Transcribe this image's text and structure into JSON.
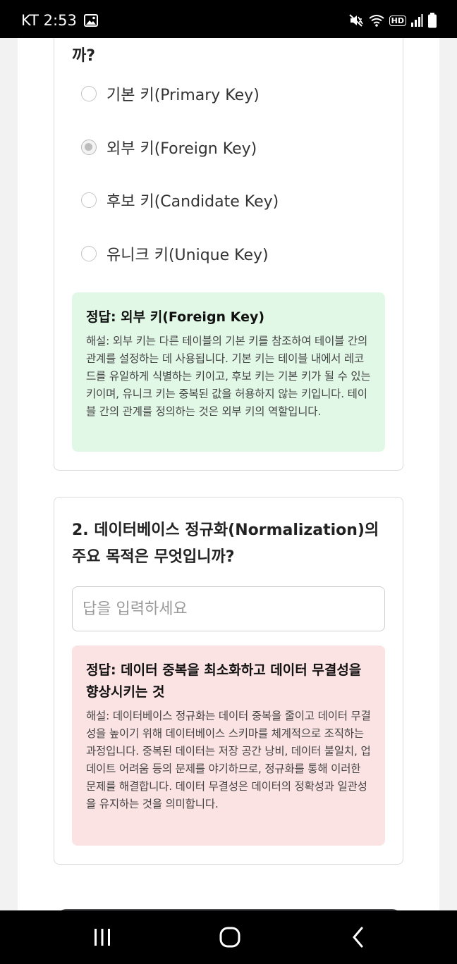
{
  "status_bar": {
    "carrier_time": "KT 2:53",
    "hd_label": "HD",
    "icons": [
      "image-icon",
      "mute-icon",
      "wifi-icon",
      "hd-icon",
      "signal-icon",
      "battery-icon"
    ]
  },
  "question1": {
    "title_tail": "까?",
    "options": [
      {
        "label": "기본 키(Primary Key)",
        "selected": false
      },
      {
        "label": "외부 키(Foreign Key)",
        "selected": true
      },
      {
        "label": "후보 키(Candidate Key)",
        "selected": false
      },
      {
        "label": "유니크 키(Unique Key)",
        "selected": false
      }
    ],
    "answer": {
      "title": "정답: 외부 키(Foreign Key)",
      "explanation": "해설: 외부 키는 다른 테이블의 기본 키를 참조하여 테이블 간의 관계를 설정하는 데 사용됩니다. 기본 키는 테이블 내에서 레코드를 유일하게 식별하는 키이고, 후보 키는 기본 키가 될 수 있는 키이며, 유니크 키는 중복된 값을 허용하지 않는 키입니다. 테이블 간의 관계를 정의하는 것은 외부 키의 역할입니다.",
      "color": "#e1f8e6"
    }
  },
  "question2": {
    "title": "2. 데이터베이스 정규화(Normalization)의 주요 목적은 무엇입니까?",
    "input": {
      "value": "",
      "placeholder": "답을 입력하세요"
    },
    "answer": {
      "title": "정답: 데이터 중복을 최소화하고 데이터 무결성을 향상시키는 것",
      "explanation": "해설: 데이터베이스 정규화는 데이터 중복을 줄이고 데이터 무결성을 높이기 위해 데이터베이스 스키마를 체계적으로 조직하는 과정입니다. 중복된 데이터는 저장 공간 낭비, 데이터 불일치, 업데이트 어려움 등의 문제를 야기하므로, 정규화를 통해 이러한 문제를 해결합니다. 데이터 무결성은 데이터의 정확성과 일관성을 유지하는 것을 의미합니다.",
      "color": "#fbe2e3"
    }
  },
  "nav_bar": {
    "icons": [
      "recent-apps-icon",
      "home-icon",
      "back-icon"
    ]
  }
}
